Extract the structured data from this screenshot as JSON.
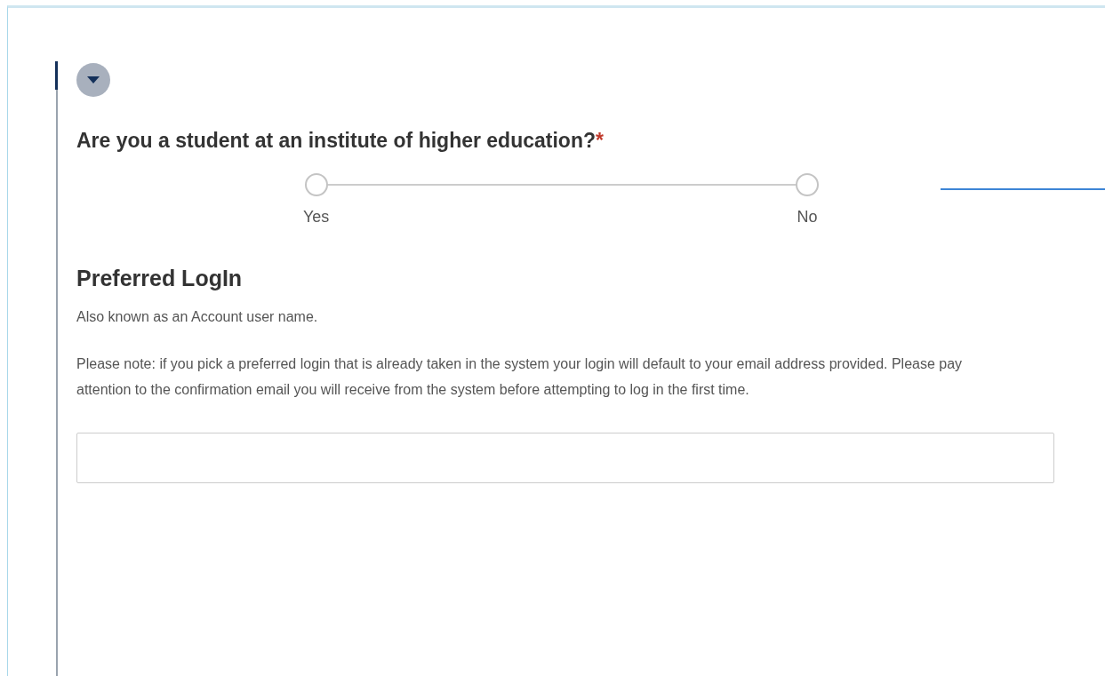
{
  "section": {
    "expanded": true
  },
  "question": {
    "text": "Are you a student at an institute of higher education?",
    "required_mark": "*",
    "options": [
      {
        "label": "Yes",
        "selected": false
      },
      {
        "label": "No",
        "selected": false
      }
    ]
  },
  "login": {
    "heading": "Preferred LogIn",
    "subtitle": "Also known as an Account user name.",
    "note": "Please note: if you pick a preferred login that is already taken in the system your login will default to your email address provided. Please pay attention to the confirmation email you will receive from the system before attempting to log in the first time."
  }
}
